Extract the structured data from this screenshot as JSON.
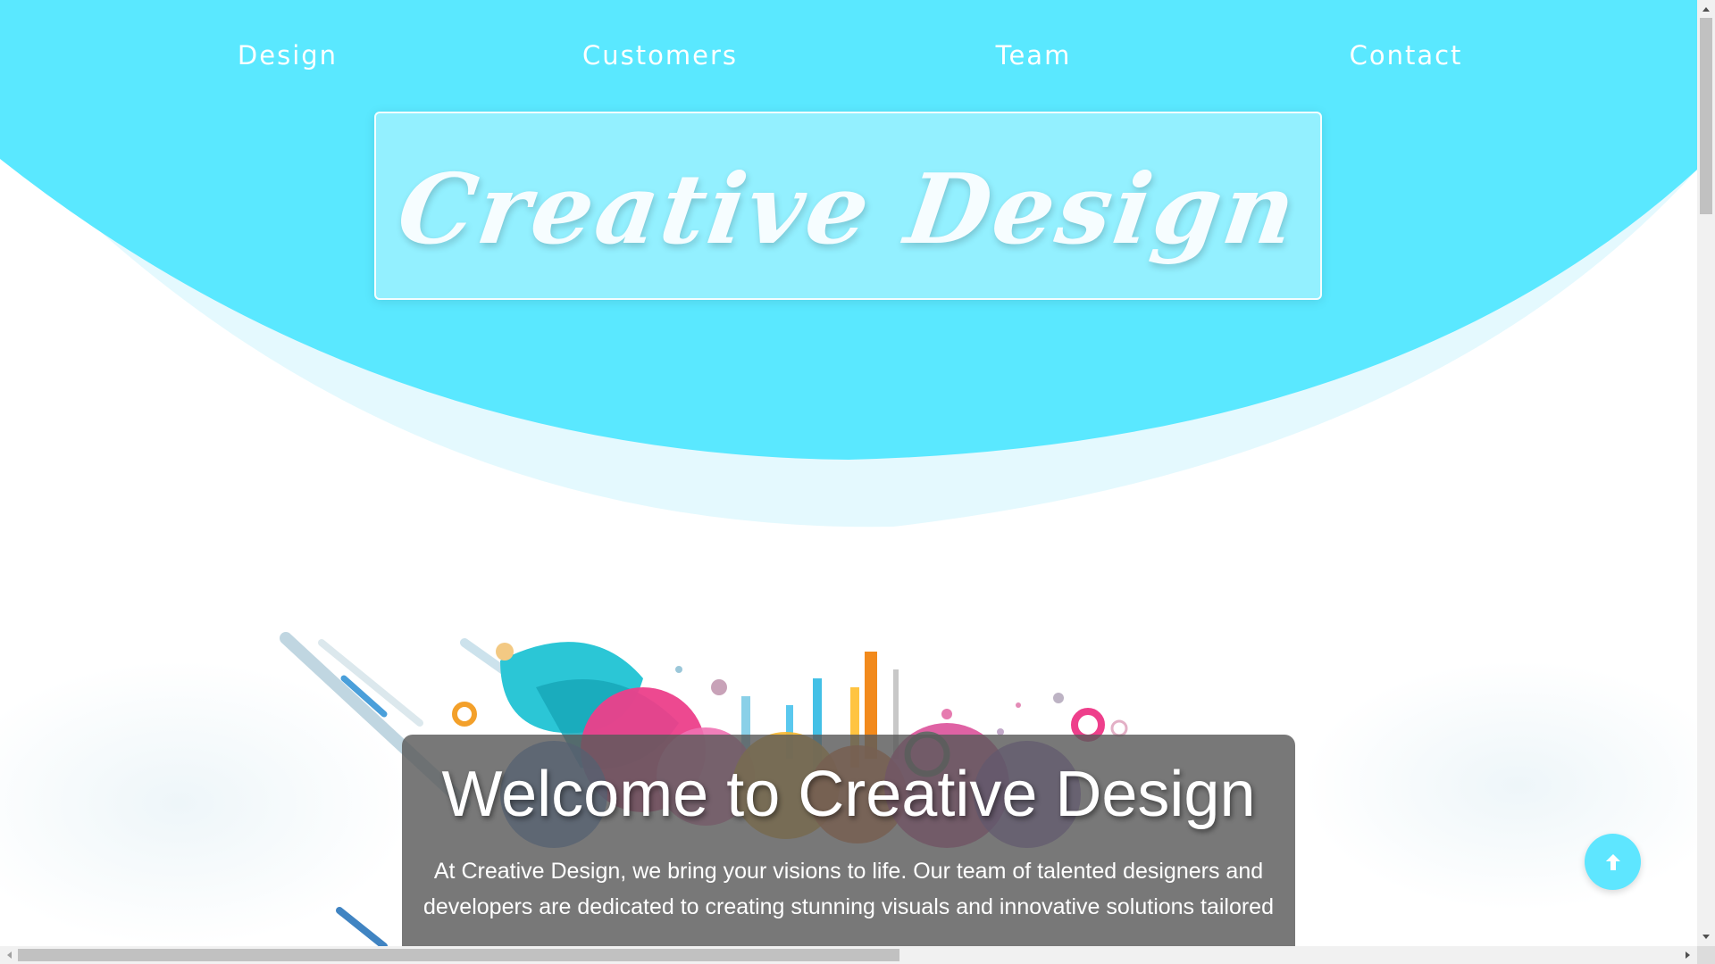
{
  "nav": {
    "items": [
      {
        "label": "Design"
      },
      {
        "label": "Customers"
      },
      {
        "label": "Team"
      },
      {
        "label": "Contact"
      }
    ]
  },
  "hero": {
    "title": "Creative Design"
  },
  "welcome": {
    "title": "Welcome to Creative Design",
    "text": "At Creative Design, we bring your visions to life. Our team of talented designers and developers are dedicated to creating stunning visuals and innovative solutions tailored"
  },
  "scroll_top": {
    "icon": "arrow-up-icon"
  },
  "colors": {
    "accent": "#5ae8ff",
    "accent_light": "#e2f9fe",
    "card_bg": "#5a5a5a",
    "text_light": "#ffffff"
  }
}
